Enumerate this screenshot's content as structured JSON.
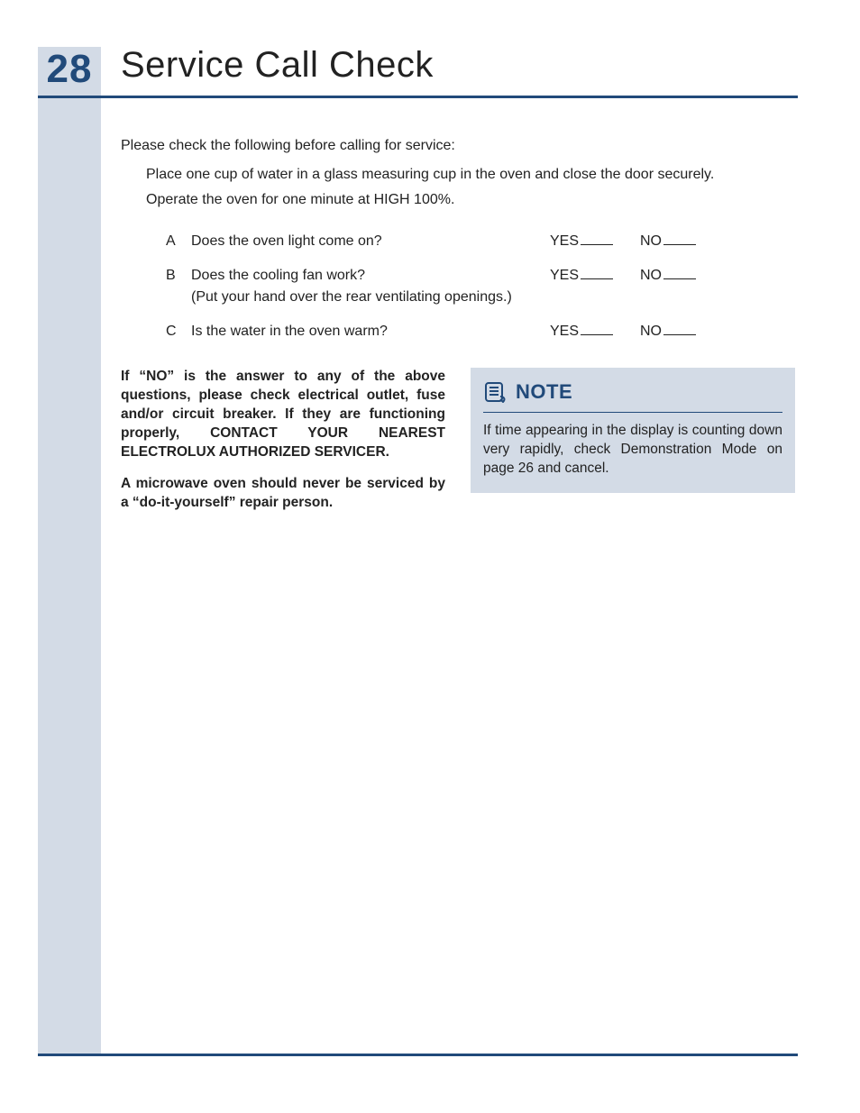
{
  "pageNumber": "28",
  "title": "Service Call Check",
  "intro": "Please check the following before calling for service:",
  "instructions": [
    "Place one cup of water in a glass measuring cup in the oven and close the door securely.",
    "Operate the oven for one minute at HIGH 100%."
  ],
  "yes": "YES",
  "no": "NO",
  "checks": [
    {
      "letter": "A",
      "question": "Does the oven light come on?",
      "sub": ""
    },
    {
      "letter": "B",
      "question": "Does the cooling fan work?",
      "sub": "(Put your hand over the rear ventilating openings.)"
    },
    {
      "letter": "C",
      "question": "Is the water in the oven warm?",
      "sub": ""
    }
  ],
  "warn1a": "If “NO” is the answer to any of the above questions, please check electrical outlet, fuse and/or circuit breaker. If they are functioning properly, ",
  "warn1b": "CONTACT YOUR NEAREST ELECTROLUX AUTHORIZED SERVICER.",
  "warn2": "A microwave oven should never be serviced by a “do-it-yourself” repair person.",
  "noteTitle": "NOTE",
  "noteBody": "If time appearing in the display is counting down very rapidly, check Demonstration Mode on page 26 and cancel."
}
